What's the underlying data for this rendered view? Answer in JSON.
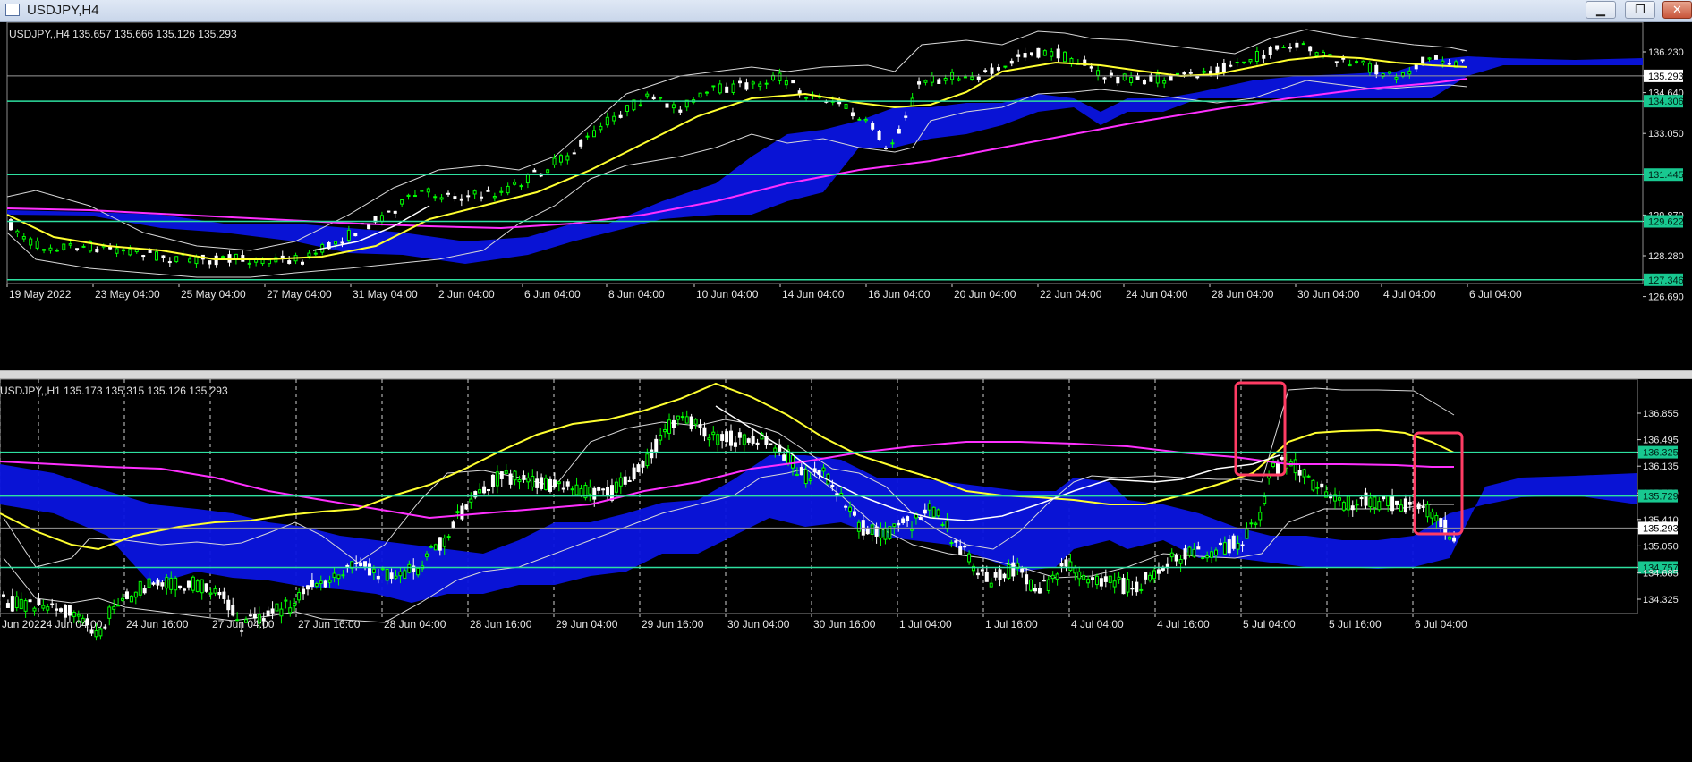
{
  "window": {
    "title": "USDJPY,H4",
    "min_icon": "minimize-icon",
    "max_icon": "maximize-icon",
    "close_icon": "close-icon"
  },
  "top_chart": {
    "header": "USDJPY,,H4  135.657 135.666 135.126 135.293",
    "price_labels": [
      "136.230",
      "135.293",
      "134.640",
      "134.306",
      "133.050",
      "131.445",
      "129.870",
      "129.622",
      "128.280",
      "127.346",
      "126.690"
    ],
    "time_labels": [
      "19 May 2022",
      "23 May 04:00",
      "25 May 04:00",
      "27 May 04:00",
      "31 May 04:00",
      "2 Jun 04:00",
      "6 Jun 04:00",
      "8 Jun 04:00",
      "10 Jun 04:00",
      "14 Jun 04:00",
      "16 Jun 04:00",
      "20 Jun 04:00",
      "22 Jun 04:00",
      "24 Jun 04:00",
      "28 Jun 04:00",
      "30 Jun 04:00",
      "4 Jul 04:00",
      "6 Jul 04:00"
    ],
    "horizontal_levels": [
      "134.306",
      "131.445",
      "129.622",
      "127.346"
    ],
    "current_price": "135.293"
  },
  "bottom_chart": {
    "header": "USDJPY,,H1  135.173 135.315 135.126 135.293",
    "price_labels": [
      "136.855",
      "136.495",
      "136.325",
      "136.135",
      "135.770",
      "135.729",
      "135.410",
      "135.293",
      "135.050",
      "134.757",
      "134.685",
      "134.325"
    ],
    "time_labels": [
      "Jun 2022",
      "24 Jun 04:00",
      "24 Jun 16:00",
      "27 Jun 04:00",
      "27 Jun 16:00",
      "28 Jun 04:00",
      "28 Jun 16:00",
      "29 Jun 04:00",
      "29 Jun 16:00",
      "30 Jun 04:00",
      "30 Jun 16:00",
      "1 Jul 04:00",
      "1 Jul 16:00",
      "4 Jul 04:00",
      "4 Jul 16:00",
      "5 Jul 04:00",
      "5 Jul 16:00",
      "6 Jul 04:00"
    ],
    "horizontal_levels": [
      "136.325",
      "135.729",
      "134.757"
    ],
    "current_price": "135.293",
    "highlight_boxes": 2
  },
  "colors": {
    "background": "#000000",
    "bull_candle": "#00ff00",
    "bear_candle": "#ffffff",
    "level_line": "#2ee0a0",
    "level_label_bg": "#18c890",
    "cloud": "#0a14e0",
    "ma_fast": "#ffff30",
    "ma_slow": "#ff30ff",
    "bollinger": "#d8d8d8",
    "highlight": "#ff3c64"
  }
}
